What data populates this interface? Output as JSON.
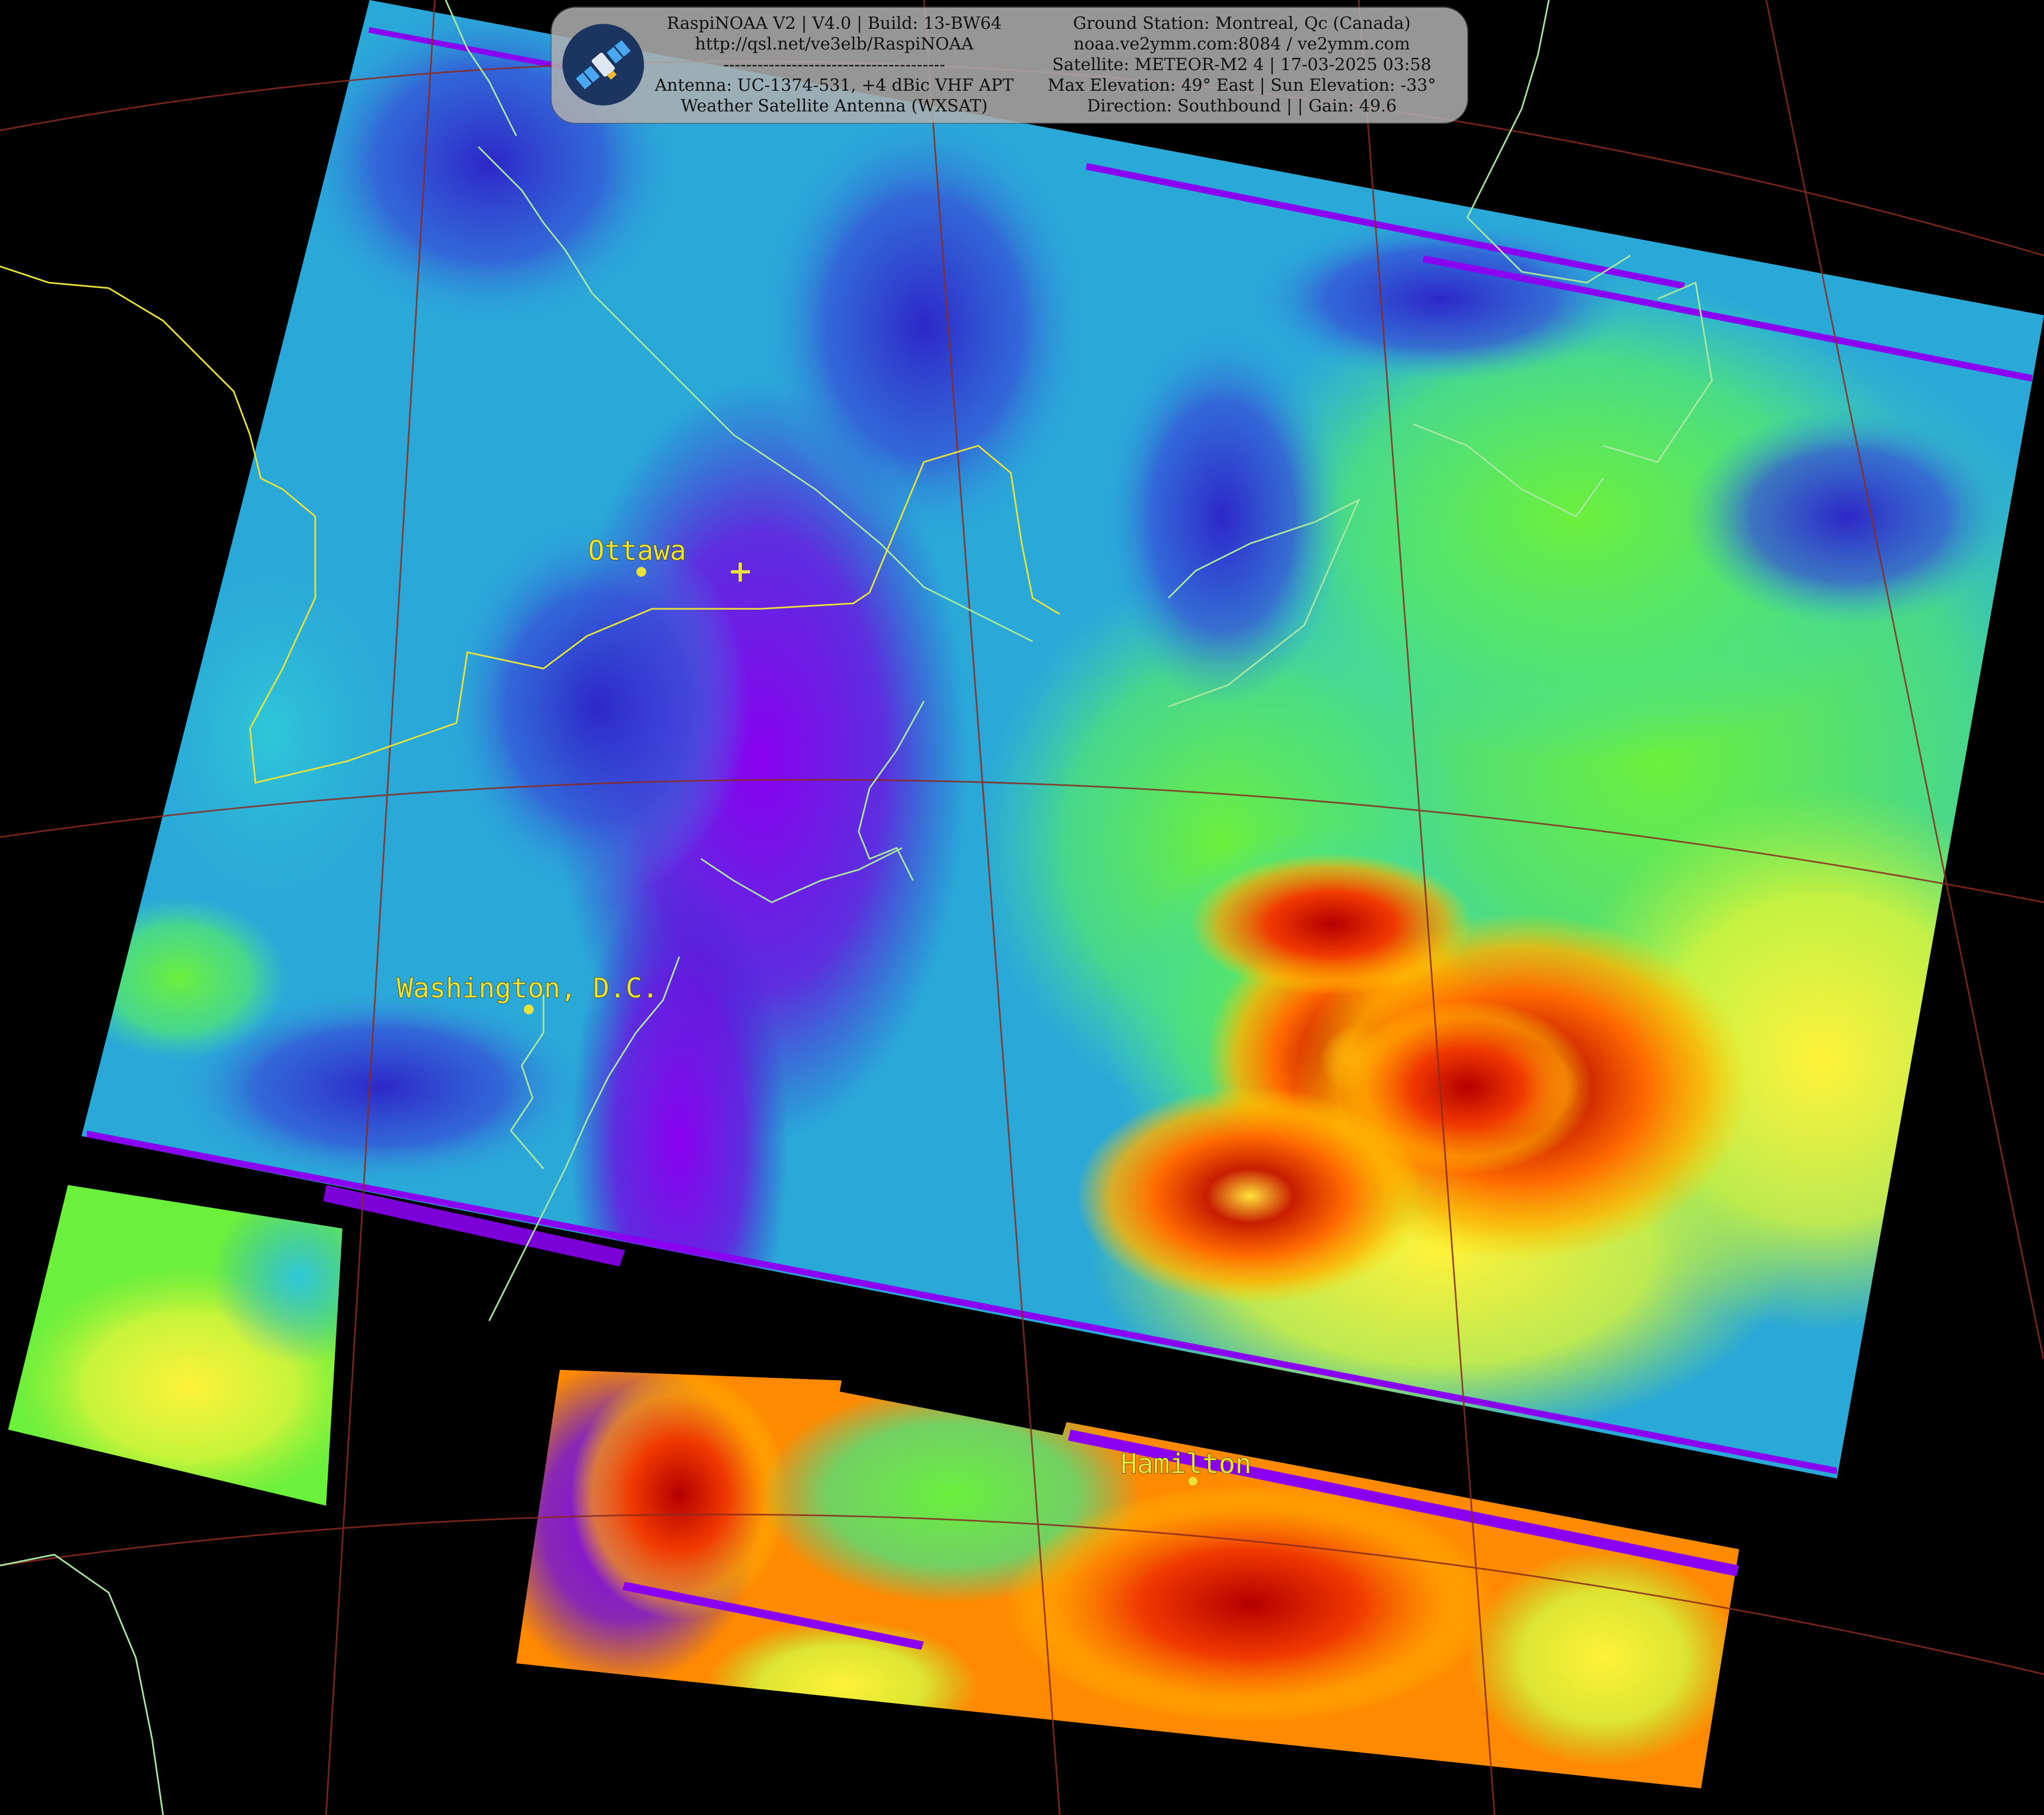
{
  "header": {
    "left_lines": [
      "RaspiNOAA V2 | V4.0 | Build: 13-BW64",
      "http://qsl.net/ve3elb/RaspiNOAA",
      "---------------------------------------",
      "Antenna: UC-1374-531, +4 dBic VHF APT",
      "Weather Satellite Antenna (WXSAT)"
    ],
    "right_lines": [
      "Ground Station: Montreal, Qc (Canada)",
      "noaa.ve2ymm.com:8084 / ve2ymm.com",
      "Satellite: METEOR-M2 4 | 17-03-2025 03:58",
      "Max Elevation: 49° East | Sun Elevation: -33°",
      "Direction: Southbound | | Gain: 49.6"
    ],
    "logo_icon": "satellite-icon"
  },
  "map": {
    "cities": [
      {
        "name": "Ottawa"
      },
      {
        "name": "Washington, D.C."
      },
      {
        "name": "Hamilton"
      }
    ],
    "ground_station_marker": "plus-icon",
    "colors": {
      "background": "#000000",
      "coastline": "#a8e6a0",
      "border": "#e8e23a",
      "graticule": "#8a2b1e",
      "label": "#e8e23a"
    }
  }
}
